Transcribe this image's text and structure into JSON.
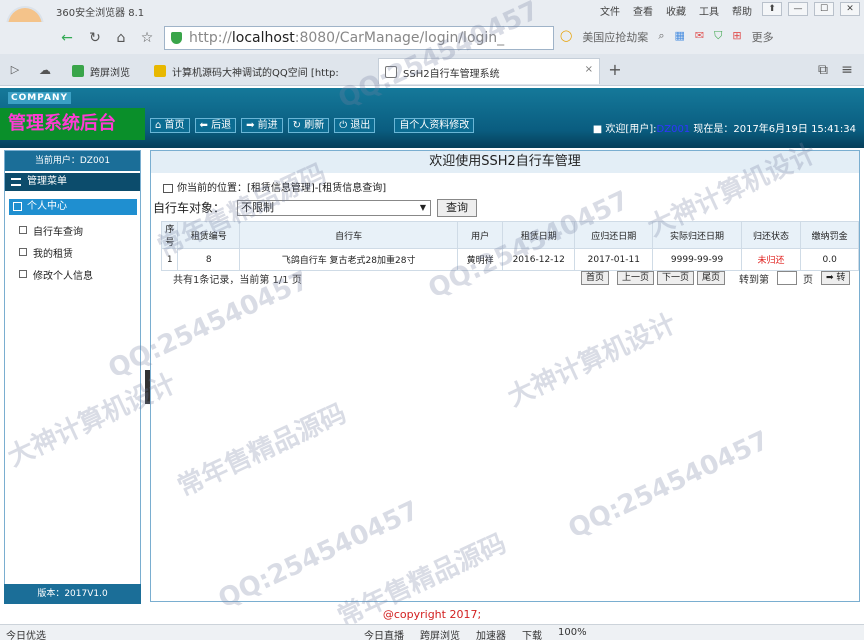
{
  "browser": {
    "title": "360安全浏览器 8.1",
    "menu": [
      "文件",
      "查看",
      "收藏",
      "工具",
      "帮助"
    ],
    "url_protocol": "http://",
    "url_host": "localhost",
    "url_rest": ":8080/CarManage/login/login_",
    "search_text": "美国应抢劫案",
    "more_label": "更多",
    "tabs": [
      {
        "label": "跨屏浏览"
      },
      {
        "label": "计算机源码大神调试的QQ空间 [http:"
      },
      {
        "label": "SSH2自行车管理系统"
      }
    ]
  },
  "header": {
    "company": "COMPANY",
    "system_title": "管理系统后台",
    "nav": [
      "首页",
      "后退",
      "前进",
      "刷新",
      "退出"
    ],
    "edit_profile": "自个人资料修改",
    "welcome_prefix": "欢迎[用户]:",
    "welcome_user": "DZ001",
    "now_label": "现在是：2017年6月19日 15:41:34"
  },
  "sidebar": {
    "current_user": "当前用户：DZ001",
    "menu_title": "管理菜单",
    "group": "个人中心",
    "items": [
      "自行车查询",
      "我的租赁",
      "修改个人信息"
    ],
    "version": "版本：2017V1.0"
  },
  "main": {
    "title": "欢迎使用SSH2自行车管理",
    "location": "你当前的位置：[租赁信息管理]-[租赁信息查询]",
    "filter_label": "自行车对象：",
    "filter_value": "不限制",
    "query_button": "查询",
    "columns": [
      "序号",
      "租赁编号",
      "自行车",
      "用户",
      "租赁日期",
      "应归还日期",
      "实际归还日期",
      "归还状态",
      "缴纳罚金"
    ],
    "rows": [
      [
        "1",
        "8",
        "飞鸽自行车 复古老式28加重28寸",
        "黄明祥",
        "2016-12-12",
        "2017-01-11",
        "9999-99-99",
        "未归还",
        "0.0"
      ]
    ],
    "pager_text": "共有1条记录，当前第 1/1 页",
    "pager_buttons": [
      "首页",
      "上一页",
      "下一页",
      "尾页"
    ],
    "goto_label": "转到第",
    "page_unit": "页",
    "go_button": "转"
  },
  "footer": "@copyright 2017;",
  "statusbar": {
    "left": "今日优选",
    "right": [
      "今日直播",
      "跨屏浏览",
      "加速器",
      "下载",
      "100%"
    ]
  },
  "watermark": {
    "qq": "QQ:254540457",
    "cn1": "大神计算机设计",
    "cn2": "常年售精品源码"
  }
}
